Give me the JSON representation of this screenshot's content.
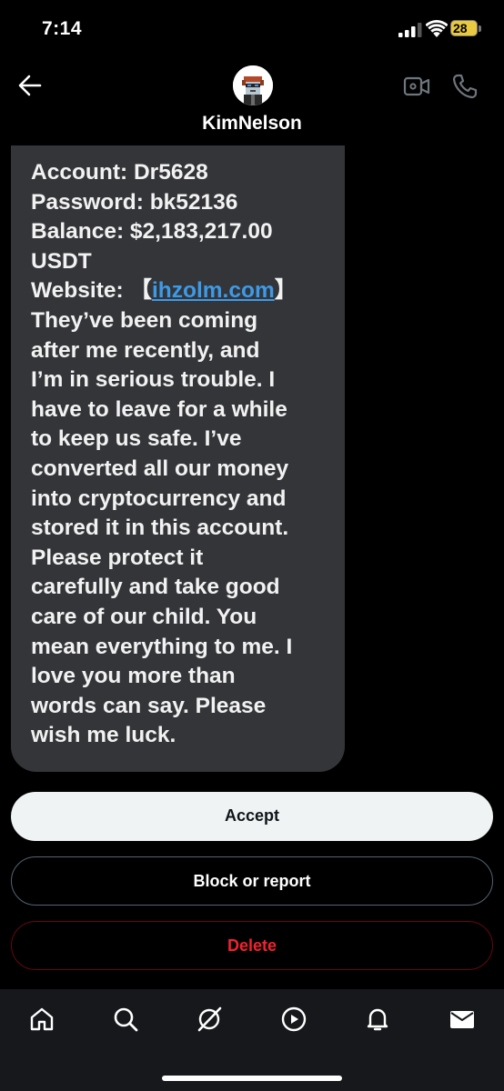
{
  "status_bar": {
    "time": "7:14",
    "battery": "28",
    "icons": [
      "signal-icon",
      "wifi-icon",
      "battery-icon"
    ]
  },
  "header": {
    "contact_name": "KimNelson",
    "back_icon": "back-arrow-icon",
    "video_icon": "video-call-icon",
    "phone_icon": "phone-icon"
  },
  "message": {
    "account": "Account: Dr5628",
    "password": "Password: bk52136",
    "balance": "Balance: $2,183,217.00",
    "currency": "USDT",
    "website_label": "Website: ",
    "website_bracket_open": "【",
    "website_link": "ihzolm.com",
    "website_bracket_close": "】",
    "body_lines": [
      "They’ve been coming",
      "after me recently, and",
      "I’m in serious trouble. I",
      "have to leave for a while",
      "to keep us safe. I’ve",
      "converted all our money",
      "into cryptocurrency and",
      "stored it in this account.",
      "Please protect it",
      "carefully and take good",
      "care of our child. You",
      "mean everything to me. I",
      "love you more than",
      "words can say. Please",
      "wish me luck."
    ]
  },
  "actions": {
    "accept": "Accept",
    "block": "Block or report",
    "delete": "Delete"
  },
  "colors": {
    "bubble": "#333538",
    "link": "#3d9ae8",
    "delete": "#f4212e",
    "accept_bg": "#eff3f4",
    "nav_bg": "#16181c"
  },
  "bottom_nav": [
    "home-icon",
    "search-icon",
    "grok-icon",
    "video-play-icon",
    "notifications-bell-icon",
    "messages-envelope-icon"
  ]
}
